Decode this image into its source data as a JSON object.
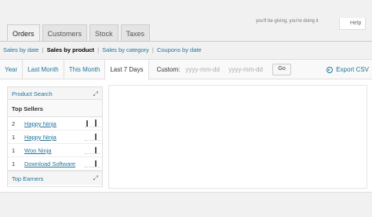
{
  "top_right": {
    "faded_text": "you'll be giving, you're doing it",
    "help_label": "Help"
  },
  "nav_tabs": [
    {
      "label": "Orders",
      "active": true
    },
    {
      "label": "Customers",
      "active": false
    },
    {
      "label": "Stock",
      "active": false
    },
    {
      "label": "Taxes",
      "active": false
    }
  ],
  "subnav": {
    "items": [
      "Sales by date",
      "Sales by product",
      "Sales by category",
      "Coupons by date"
    ],
    "separator": "|",
    "current_index": 1
  },
  "ranges": [
    {
      "label": "Year",
      "active": false
    },
    {
      "label": "Last Month",
      "active": false
    },
    {
      "label": "This Month",
      "active": false
    },
    {
      "label": "Last 7 Days",
      "active": true
    }
  ],
  "custom": {
    "label": "Custom:",
    "from_placeholder": "yyyy-mm-dd",
    "to_placeholder": "yyyy-mm-dd",
    "go_label": "Go"
  },
  "export": {
    "label": "Export CSV",
    "icon": "export-icon"
  },
  "sidebar": {
    "product_search": "Product Search",
    "top_sellers": "Top Sellers",
    "sellers": [
      {
        "count": "2",
        "name": "Happy Ninja",
        "spark": [
          0.8,
          0.9
        ]
      },
      {
        "count": "1",
        "name": "Happy Ninja",
        "spark": [
          0.8
        ]
      },
      {
        "count": "1",
        "name": "Woo Ninja",
        "spark": [
          0.8
        ]
      },
      {
        "count": "1",
        "name": "Download Software",
        "spark": [
          0.8
        ]
      }
    ],
    "top_earners": "Top Earners",
    "expand_icon": "expand-icon"
  },
  "colors": {
    "link": "#21759b",
    "border": "#dfdfdf",
    "background": "#f1f1f1"
  }
}
